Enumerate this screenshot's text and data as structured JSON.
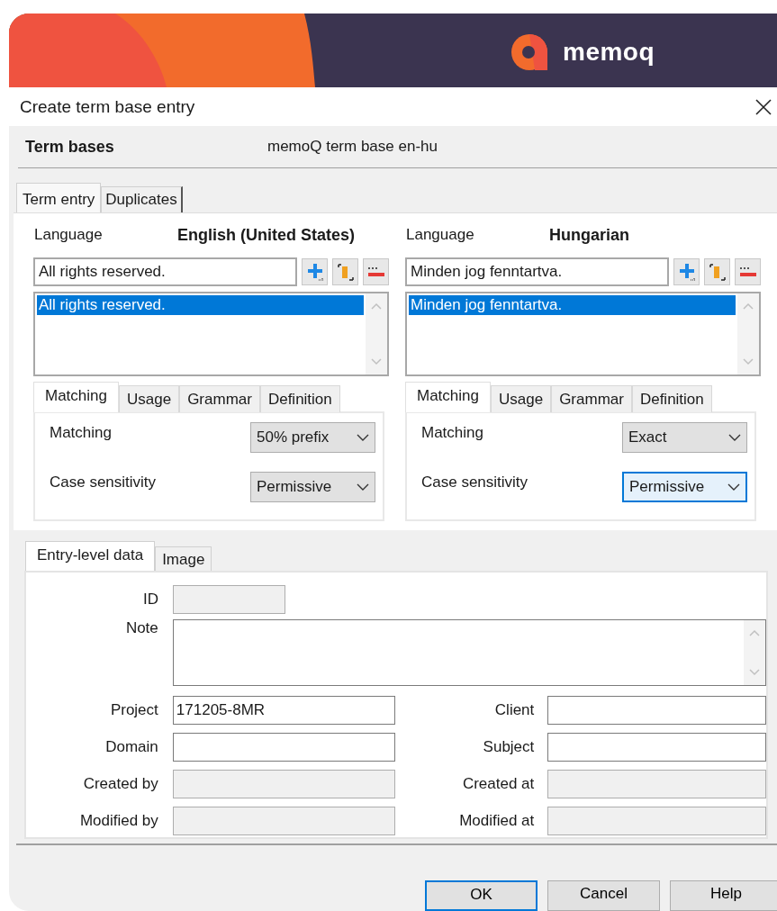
{
  "header": {
    "logo_text": "memoq"
  },
  "window": {
    "title": "Create term base entry"
  },
  "term_bases": {
    "label": "Term bases",
    "value": "memoQ term base en-hu"
  },
  "tabs": [
    {
      "label": "Term entry",
      "selected": true
    },
    {
      "label": "Duplicates",
      "selected": false
    }
  ],
  "languages": [
    {
      "label": "Language",
      "name": "English (United States)",
      "term": "All rights reserved.",
      "terms": [
        {
          "text": "All rights reserved.",
          "selected": true
        }
      ],
      "subtabs": [
        {
          "label": "Matching",
          "selected": true
        },
        {
          "label": "Usage",
          "selected": false
        },
        {
          "label": "Grammar",
          "selected": false
        },
        {
          "label": "Definition",
          "selected": false
        }
      ],
      "settings": [
        {
          "label": "Matching",
          "value": "50% prefix",
          "focused": false
        },
        {
          "label": "Case sensitivity",
          "value": "Permissive",
          "focused": false
        }
      ]
    },
    {
      "label": "Language",
      "name": "Hungarian",
      "term": "Minden jog fenntartva.",
      "terms": [
        {
          "text": "Minden jog fenntartva.",
          "selected": true
        }
      ],
      "subtabs": [
        {
          "label": "Matching",
          "selected": true
        },
        {
          "label": "Usage",
          "selected": false
        },
        {
          "label": "Grammar",
          "selected": false
        },
        {
          "label": "Definition",
          "selected": false
        }
      ],
      "settings": [
        {
          "label": "Matching",
          "value": "Exact",
          "focused": false
        },
        {
          "label": "Case sensitivity",
          "value": "Permissive",
          "focused": true
        }
      ]
    }
  ],
  "entry_tabs": [
    {
      "label": "Entry-level data",
      "selected": true
    },
    {
      "label": "Image",
      "selected": false
    }
  ],
  "id_field": {
    "label": "ID",
    "disabled": true
  },
  "note_field": {
    "label": "Note"
  },
  "field_rows": [
    [
      {
        "label": "Project",
        "value": "171205-8MR",
        "disabled": false
      },
      {
        "label": "Client",
        "disabled": false
      }
    ],
    [
      {
        "label": "Domain",
        "disabled": false
      },
      {
        "label": "Subject",
        "disabled": false
      }
    ],
    [
      {
        "label": "Created by",
        "disabled": true
      },
      {
        "label": "Created at",
        "disabled": true
      }
    ],
    [
      {
        "label": "Modified by",
        "disabled": true
      },
      {
        "label": "Modified at",
        "disabled": true
      }
    ]
  ],
  "buttons": [
    {
      "label": "OK",
      "default": true
    },
    {
      "label": "Cancel",
      "default": false
    },
    {
      "label": "Help",
      "default": false
    }
  ]
}
